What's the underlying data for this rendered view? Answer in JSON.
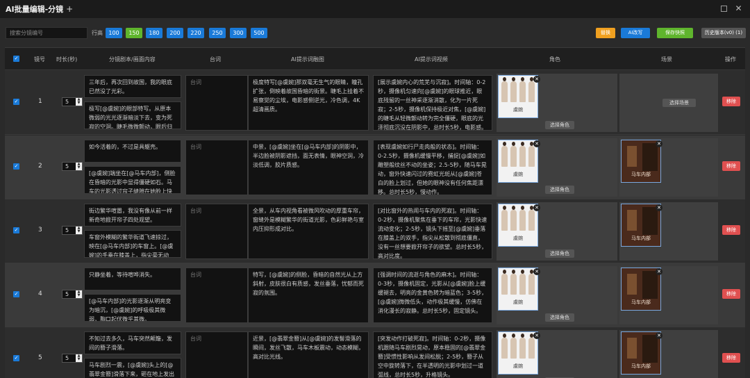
{
  "window": {
    "title": "AI批量编辑-分镜",
    "plus_icon": "+"
  },
  "toolbar": {
    "search_placeholder": "搜索分镜编号",
    "row_height_label": "行高",
    "row_heights": [
      "100",
      "150",
      "180",
      "200",
      "220",
      "250",
      "300",
      "500"
    ],
    "active_row_height": "150",
    "replace_label": "替换",
    "ai_rewrite_label": "AI改写",
    "save_label": "保存快照",
    "history_label": "历史版本(v0) (1)",
    "colors": {
      "blue": "#1a7ad8",
      "green": "#5fb52d",
      "orange": "#f0a020",
      "red": "#e05050"
    }
  },
  "table": {
    "headers": [
      "镜号",
      "时长(秒)",
      "分镜剧本/画面内容",
      "台词",
      "AI提示词融图",
      "AI提示词视频",
      "角色",
      "场景",
      "操作"
    ],
    "taici_placeholder": "台词",
    "select_role_label": "选择角色",
    "select_scene_label": "选择场景",
    "delete_label": "移除",
    "rows": [
      {
        "num": "1",
        "duration": "5",
        "script_a": "三年后，再次回到故国，我的眼底已然没了光彩。",
        "script_b": "极写[@虞婉]的眼部特写。从原本微弱的光光逐渐暗淡下去，变为死寂的空洞。睫毛微微颤动，眼后归于平静。",
        "img_prompt": "极度特写[@虞婉]那双毫无生气的眼睛，瞳孔扩张，倒映着故国昏暗的街景。睫毛上挂着不易察觉的尘埃，电影感侧逆光，冷色调，4K超清画质。",
        "vid_prompt": "[展示虞婉内心的荒芜与沉寂]。时间轴：0-2秒，摄像机匀速向[@虞婉]的眼球推近，眼底残留的一丝神采逐渐消散，化为一片死寂；2-5秒，摄像机保持极近对焦，[@虞婉]的睫毛从轻微颤动转为完全僵硬，眼底的光泽彻底沉没在阴影中，总时长5秒，电影感。",
        "role_label": "虞婉",
        "scene_label": ""
      },
      {
        "num": "2",
        "duration": "5",
        "script_a": "如今活着的，不过是具躯壳。",
        "script_b": "[@虞婉]端坐在[@马车内部]，侧脸在昏暗的光影中显得僵硬如石。马车的光影透过帘子缝隙在她脸上快速掠过。",
        "img_prompt": "中景，[@虞婉]坐在[@马车内部]的阴影中，半边脸被阴影遮挡，面无表情，眼神空洞，冷淡低调，胶片质感。",
        "vid_prompt": "[表现虞婉如行尸走肉般的状态]。时间轴：0-2.5秒，摄像机缓慢平移，捕捉[@虞婉]如雕塑般纹丝不动的坐姿；2.5-5秒，随马车晃动，窗外快速闪过的霓虹光斑从[@虞婉]苍白的脸上划过，但她的眼神没有任何焦距漂移。总时长5秒，慢动作。",
        "role_label": "虞婉",
        "scene_label": "马车内部"
      },
      {
        "num": "3",
        "duration": "5",
        "script_a": "街边繁华喧嚣，我没有像从前一样新奇地掀开帘子四处观望。",
        "script_b": "车窗外模糊的繁华街道飞速掠过，映在[@马车内部]的车窗上。[@虞婉]的手垂在膝盖上，指尖毫无动静。",
        "img_prompt": "全景，从车内视角看被微风吹动的厚重车帘，窗缝外是模糊繁华的街道光影，色彩鲜艳与室内压抑形成对比。",
        "vid_prompt": "[对比窗外的热闹与车内的死寂]。时间轴：0-2秒，摄像机聚焦在垂下的车帘，光影快速流动变化；2-5秒，镜头下摇至[@虞婉]垂落在膝盖上的双手，指尖从松散到彻底僵直，没有一丝想要掀开帘子的欲望。总时长5秒，高对比度。",
        "role_label": "虞婉",
        "scene_label": "马车内部"
      },
      {
        "num": "4",
        "duration": "5",
        "script_a": "只静坐着，等待喧哗消失。",
        "script_b": "[@马车内部]的光影逐渐从明亮变为暗沉，[@虞婉]的呼吸极其微弱，胸口起伏微乎其微。",
        "img_prompt": "特写，[@虞婉]的侧脸，昏暗的自然光从上方斜射，皮肤很白有质感，发丝垂落，忧郁而死寂的氛围。",
        "vid_prompt": "[强调时间的流逝与角色的麻木]。时间轴：0-3秒，摄像机固定，光影从[@虞婉]脸上缓缓褪去，明亮的金黄色转为暗蓝色；3-5秒，[@虞婉]微微低头，动作极其缓慢，仿佛在消化漫长的寂静。总时长5秒，固定镜头。",
        "role_label": "虞婉",
        "scene_label": "马车内部"
      },
      {
        "num": "5",
        "duration": "5",
        "script_a": "不知过去多久，马车突然颠簸，发间的簪子滑落。",
        "script_b": "马车剧烈一震，[@虞婉]头上的[@翡翠金簪]滑落下来，砸在地上发出清脆的声响。",
        "img_prompt": "近景，[@翡翠金簪]从[@虞婉]的发髻滑落的瞬间，发丝飞散，马车木板震动，动态模糊，高对比光线。",
        "vid_prompt": "[突发动作打破死寂]。时间轴：0-2秒，摄像机跟随马车剧烈晃动，原本稳固的[@翡翠金簪]受惯性影响从发间松脱；2-5秒，簪子从空中旋转落下，在半透明的光影中划过一道弧线，总时长5秒，升格镜头。",
        "role_label": "虞婉",
        "scene_label": "马车内部"
      }
    ]
  }
}
